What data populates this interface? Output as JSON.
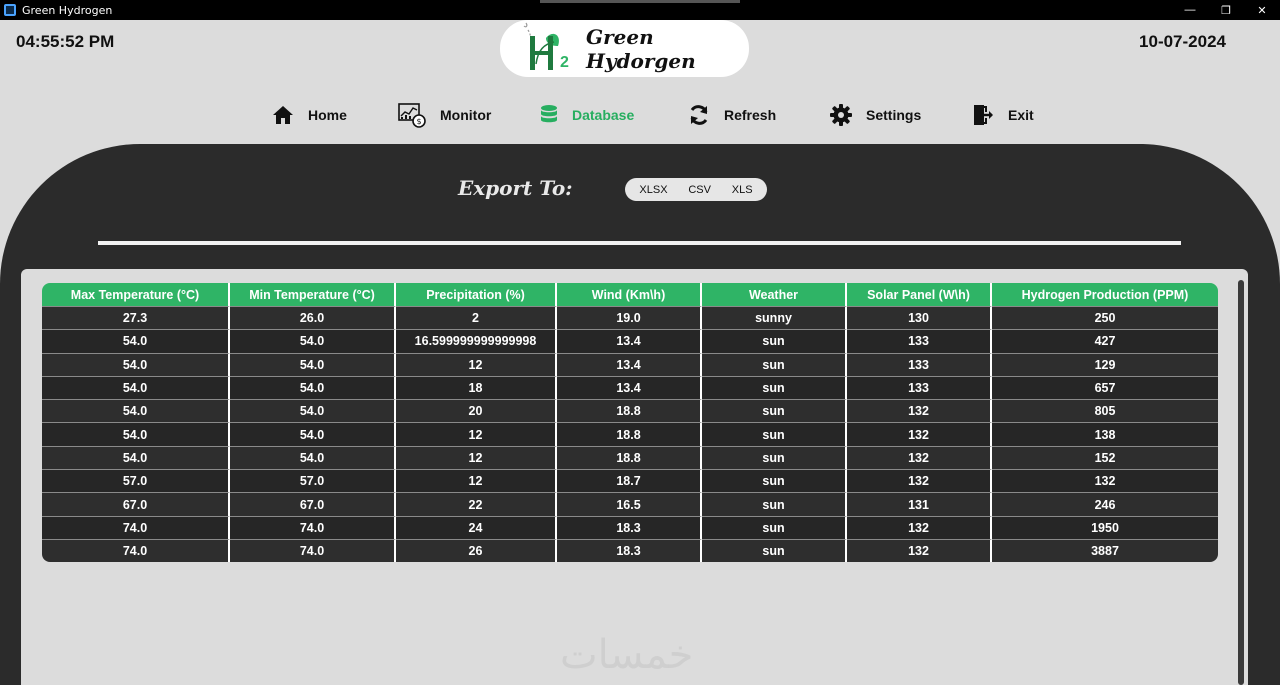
{
  "window": {
    "title": "Green Hydrogen",
    "controls": [
      "—",
      "❐",
      "✕"
    ]
  },
  "header": {
    "time": "04:55:52 PM",
    "date": "10-07-2024",
    "logo_text": "Green Hydorgen",
    "logo_mark": "H",
    "logo_sub": "2"
  },
  "nav": {
    "items": [
      {
        "label": "Home",
        "icon": "home-icon"
      },
      {
        "label": "Monitor",
        "icon": "monitor-icon"
      },
      {
        "label": "Database",
        "icon": "database-icon",
        "active": true
      },
      {
        "label": "Refresh",
        "icon": "refresh-icon"
      },
      {
        "label": "Settings",
        "icon": "gear-icon"
      },
      {
        "label": "Exit",
        "icon": "exit-icon"
      }
    ]
  },
  "export": {
    "label": "Export To:",
    "options": [
      "XLSX",
      "CSV",
      "XLS"
    ]
  },
  "table": {
    "headers": [
      "Max Temperature (°C)",
      "Min Temperature (°C)",
      "Precipitation (%)",
      "Wind (Km\\h)",
      "Weather",
      "Solar Panel (W\\h)",
      "Hydrogen Production (PPM)"
    ],
    "rows": [
      [
        "27.3",
        "26.0",
        "2",
        "19.0",
        "sunny",
        "130",
        "250"
      ],
      [
        "54.0",
        "54.0",
        "16.599999999999998",
        "13.4",
        "sun",
        "133",
        "427"
      ],
      [
        "54.0",
        "54.0",
        "12",
        "13.4",
        "sun",
        "133",
        "129"
      ],
      [
        "54.0",
        "54.0",
        "18",
        "13.4",
        "sun",
        "133",
        "657"
      ],
      [
        "54.0",
        "54.0",
        "20",
        "18.8",
        "sun",
        "132",
        "805"
      ],
      [
        "54.0",
        "54.0",
        "12",
        "18.8",
        "sun",
        "132",
        "138"
      ],
      [
        "54.0",
        "54.0",
        "12",
        "18.8",
        "sun",
        "132",
        "152"
      ],
      [
        "57.0",
        "57.0",
        "12",
        "18.7",
        "sun",
        "132",
        "132"
      ],
      [
        "67.0",
        "67.0",
        "22",
        "16.5",
        "sun",
        "131",
        "246"
      ],
      [
        "74.0",
        "74.0",
        "24",
        "18.3",
        "sun",
        "132",
        "1950"
      ],
      [
        "74.0",
        "74.0",
        "26",
        "18.3",
        "sun",
        "132",
        "3887"
      ]
    ]
  },
  "watermark": "خمسات",
  "colors": {
    "accent": "#27ae60",
    "header_green": "#2fb466",
    "dark_panel": "#2b2b2b",
    "background": "#dcdcdc"
  }
}
